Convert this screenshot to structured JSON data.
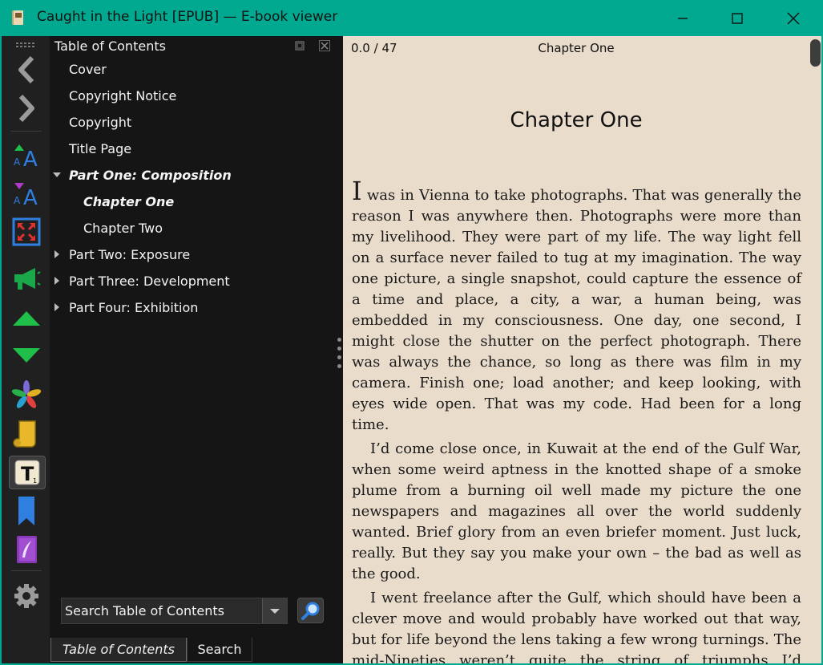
{
  "window": {
    "title": "Caught in the Light [EPUB] — E-book viewer"
  },
  "toolbar": {
    "buttons": [
      {
        "name": "back-icon"
      },
      {
        "name": "forward-icon"
      },
      {
        "name": "increase-font-icon"
      },
      {
        "name": "decrease-font-icon"
      },
      {
        "name": "fullscreen-icon"
      },
      {
        "name": "read-aloud-icon"
      },
      {
        "name": "previous-section-icon"
      },
      {
        "name": "next-section-icon"
      },
      {
        "name": "metadata-icon"
      },
      {
        "name": "toc-scroll-icon"
      },
      {
        "name": "lookup-icon"
      },
      {
        "name": "bookmark-icon"
      },
      {
        "name": "highlights-icon"
      },
      {
        "name": "settings-icon"
      }
    ]
  },
  "toc": {
    "header": "Table of Contents",
    "items": [
      {
        "label": "Cover"
      },
      {
        "label": "Copyright Notice"
      },
      {
        "label": "Copyright"
      },
      {
        "label": "Title Page"
      },
      {
        "label": "Part One: Composition"
      },
      {
        "label": "Chapter One"
      },
      {
        "label": "Chapter Two"
      },
      {
        "label": "Part Two: Exposure"
      },
      {
        "label": "Part Three: Development"
      },
      {
        "label": "Part Four: Exhibition"
      }
    ],
    "search_value": "Search Table of Contents",
    "tabs": [
      "Table of Contents",
      "Search"
    ]
  },
  "reader": {
    "progress": "0.0 / 47",
    "header": "Chapter One",
    "chapter_title": "Chapter One",
    "dropcap": "I",
    "p1": " was in Vienna to take photographs. That was generally the reason I was anywhere then. Photographs were more than my livelihood. They were part of my life. The way light fell on a surface never failed to tug at my imagination. The way one picture, a single snapshot, could capture the essence of a time and place, a city, a war, a human being, was embedded in my consciousness. One day, one second, I might close the shutter on the perfect photograph. There was always the chance, so long as there was film in my camera. Finish one; load another; and keep looking, with eyes wide open. That was my code. Had been for a long time.",
    "p2": "I’d come close once, in Kuwait at the end of the Gulf War, when some weird aptness in the knotted shape of a smoke plume from a burning oil well made my picture the one newspapers and magazines all over the world suddenly wanted. Brief glory from an even briefer moment. Just luck, really. But they say you make your own – the bad as well as the good.",
    "p3": "I went freelance after the Gulf, which should have been a clever move and would probably have worked out that way, but for life beyond the lens taking a few wrong turnings. The mid-Nineties weren’t quite the string of triumphs I’d foreseen"
  },
  "colors": {
    "titlebar": "#00a98f",
    "panel": "#151515",
    "page": "#eadccb",
    "accent_green": "#1fbf4a",
    "accent_blue": "#2f7fe0"
  }
}
